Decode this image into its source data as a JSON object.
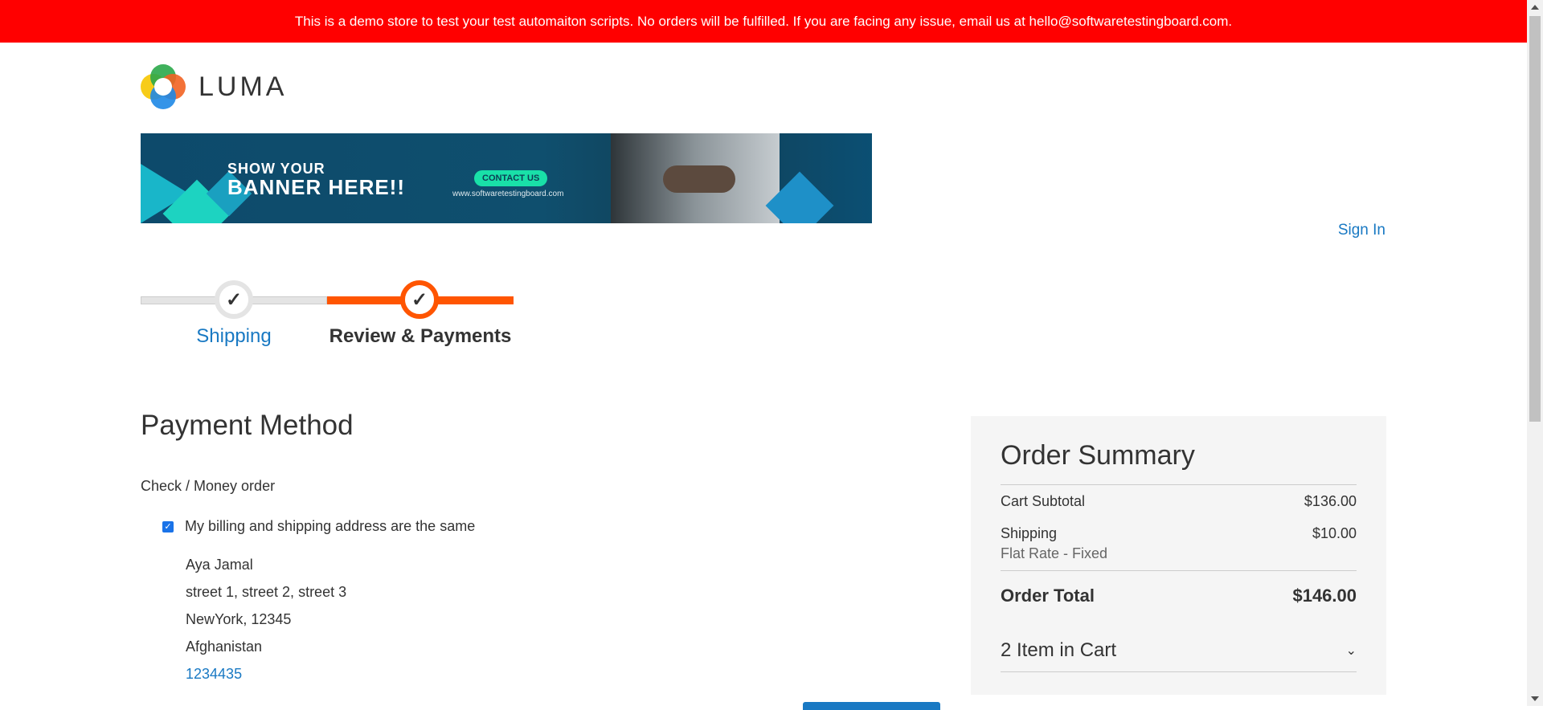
{
  "notice_bar": {
    "text": "This is a demo store to test your test automaiton scripts. No orders will be fulfilled. If you are facing any issue, email us at hello@softwaretestingboard.com."
  },
  "header": {
    "logo_text": "LUMA",
    "sign_in": "Sign In"
  },
  "banner": {
    "line1": "SHOW YOUR",
    "line2": "BANNER HERE!!",
    "contact": "CONTACT US",
    "site": "www.softwaretestingboard.com"
  },
  "progress": {
    "steps": [
      {
        "label": "Shipping",
        "state": "complete"
      },
      {
        "label": "Review & Payments",
        "state": "current"
      }
    ]
  },
  "payment": {
    "title": "Payment Method",
    "method": "Check / Money order",
    "same_address_label": "My billing and shipping address are the same",
    "same_address_checked": true,
    "address": {
      "name": "Aya Jamal",
      "street": "street 1, street 2, street 3",
      "city_zip": "NewYork, 12345",
      "country": "Afghanistan",
      "phone": "1234435"
    }
  },
  "summary": {
    "title": "Order Summary",
    "subtotal_label": "Cart Subtotal",
    "subtotal_value": "$136.00",
    "shipping_label": "Shipping",
    "shipping_value": "$10.00",
    "shipping_method": "Flat Rate - Fixed",
    "total_label": "Order Total",
    "total_value": "$146.00",
    "items_in_cart": "2 Item in Cart"
  },
  "colors": {
    "notice": "#ff0000",
    "accent": "#ff5501",
    "link": "#1979c3",
    "summary_bg": "#f5f5f5"
  }
}
